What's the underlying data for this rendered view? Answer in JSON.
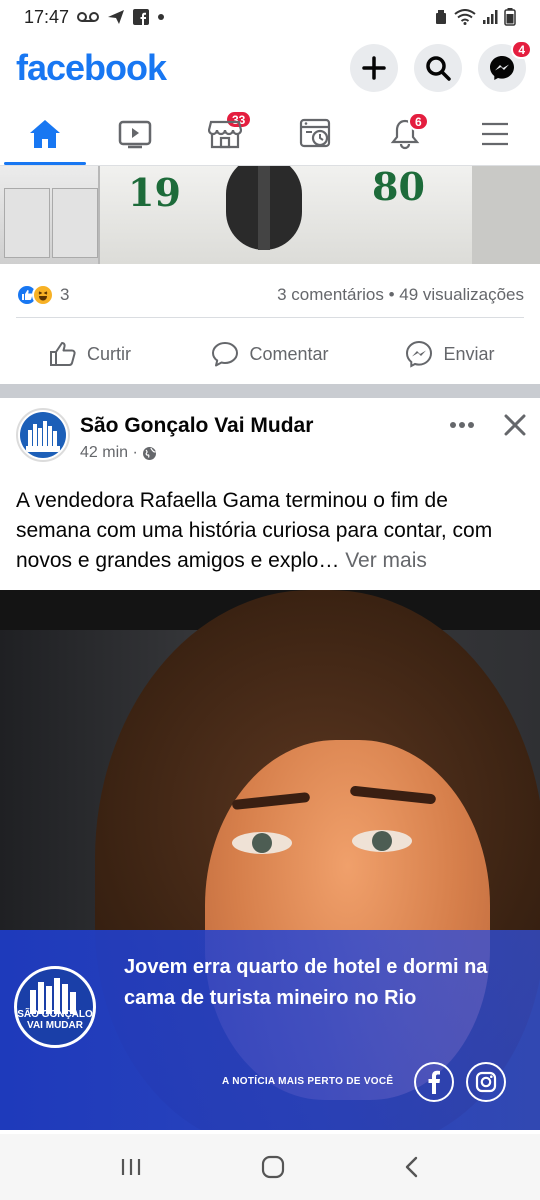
{
  "status_bar": {
    "time": "17:47",
    "left_icons": [
      "voicemail-icon",
      "send-icon",
      "facebook-icon",
      "dot-icon"
    ],
    "right_icons": [
      "recycle-icon",
      "wifi-icon",
      "signal-icon",
      "battery-icon"
    ]
  },
  "header": {
    "brand": "facebook",
    "messenger_badge": "4"
  },
  "tabs": [
    {
      "name": "home",
      "icon": "home-icon",
      "badge": ""
    },
    {
      "name": "watch",
      "icon": "video-icon",
      "badge": "33"
    },
    {
      "name": "marketplace",
      "icon": "store-icon",
      "badge": ""
    },
    {
      "name": "memories",
      "icon": "clock-icon",
      "badge": ""
    },
    {
      "name": "notifications",
      "icon": "bell-icon",
      "badge": "6"
    },
    {
      "name": "menu",
      "icon": "menu-icon",
      "badge": ""
    }
  ],
  "previous_post": {
    "image_text_left": "19",
    "image_text_right": "80",
    "reaction_count": "3",
    "stats": "3 comentários • 49 visualizações",
    "actions": {
      "like": "Curtir",
      "comment": "Comentar",
      "share": "Enviar"
    }
  },
  "post": {
    "page_name": "São Gonçalo Vai Mudar",
    "time": "42 min ·",
    "text": "A vendedora Rafaella Gama terminou o fim de semana com uma história curiosa para contar, com novos e grandes amigos e explo…",
    "see_more": "Ver mais",
    "image": {
      "headline": "Jovem erra quarto de hotel e dormi na cama de turista mineiro no Rio",
      "logo_text": "SÃO GONÇALO VAI MUDAR",
      "tagline": "A NOTÍCIA MAIS PERTO DE VOCÊ",
      "social_icons": [
        "facebook-icon",
        "instagram-icon"
      ]
    }
  },
  "colors": {
    "brand_blue": "#1877f2",
    "badge_red": "#e41e3f",
    "banner_blue": "#1e3cc8"
  }
}
